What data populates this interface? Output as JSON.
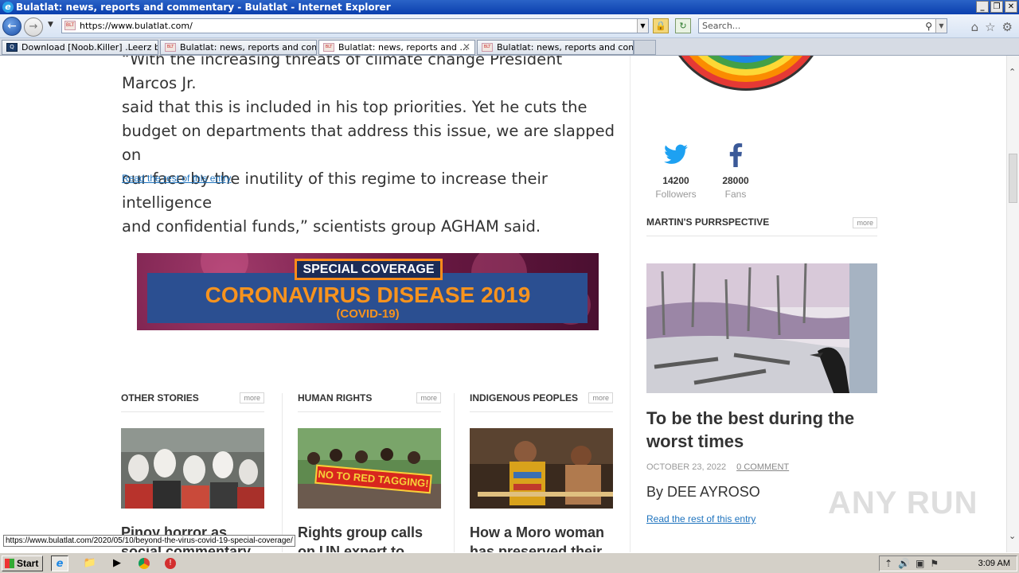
{
  "window": {
    "title": "Bulatlat: news, reports and commentary - Bulatlat - Internet Explorer",
    "controls": [
      "_",
      "❐",
      "✕"
    ]
  },
  "navbar": {
    "url": "https://www.bulatlat.com/",
    "search_placeholder": "Search..."
  },
  "tabs": [
    {
      "label": "Download [Noob.Killer] .Leerz b...",
      "favicon": "anyrun"
    },
    {
      "label": "Bulatlat: news, reports and com...",
      "favicon": "bulatlat"
    },
    {
      "label": "Bulatlat: news, reports and ...",
      "favicon": "bulatlat",
      "active": true
    },
    {
      "label": "Bulatlat: news, reports and com...",
      "favicon": "bulatlat"
    }
  ],
  "article": {
    "line0": "“With the increasing threats of climate change President Marcos Jr.",
    "line1": "said that this is included in his top priorities. Yet he cuts the",
    "line2": "budget on departments that address this issue, we are slapped on",
    "line3": "our face by the inutility of this regime to increase their intelligence",
    "line4": "and confidential funds,” scientists group AGHAM said.",
    "read_more": "Read the rest of this entry"
  },
  "banner": {
    "tag": "SPECIAL COVERAGE",
    "headline": "CORONAVIRUS DISEASE 2019",
    "sub": "(COVID-19)"
  },
  "sections": [
    {
      "heading": "OTHER STORIES",
      "more": "more",
      "title": "Pinoy horror as social commentary"
    },
    {
      "heading": "HUMAN RIGHTS",
      "more": "more",
      "title": "Rights group calls on UN expert to"
    },
    {
      "heading": "INDIGENOUS PEOPLES",
      "more": "more",
      "title": "How a Moro woman has preserved their"
    }
  ],
  "human_rights_sign": "NO TO RED TAGGING!",
  "social": {
    "twitter": {
      "count": "14200",
      "label": "Followers"
    },
    "facebook": {
      "count": "28000",
      "label": "Fans"
    }
  },
  "sidebar": {
    "heading": "MARTIN'S PURRSPECTIVE",
    "more": "more",
    "title": "To be the best during the worst times",
    "date": "OCTOBER 23, 2022",
    "comment": "0 COMMENT",
    "author": "By DEE AYROSO",
    "read_more": "Read the rest of this entry"
  },
  "status_url": "https://www.bulatlat.com/2020/05/10/beyond-the-virus-covid-19-special-coverage/",
  "watermark": "ANY RUN",
  "taskbar": {
    "start": "Start",
    "clock": "3:09 AM"
  },
  "colors": {
    "link": "#1e73be",
    "banner_orange": "#f7931e",
    "twitter": "#1da1f2",
    "facebook": "#3b5998"
  }
}
